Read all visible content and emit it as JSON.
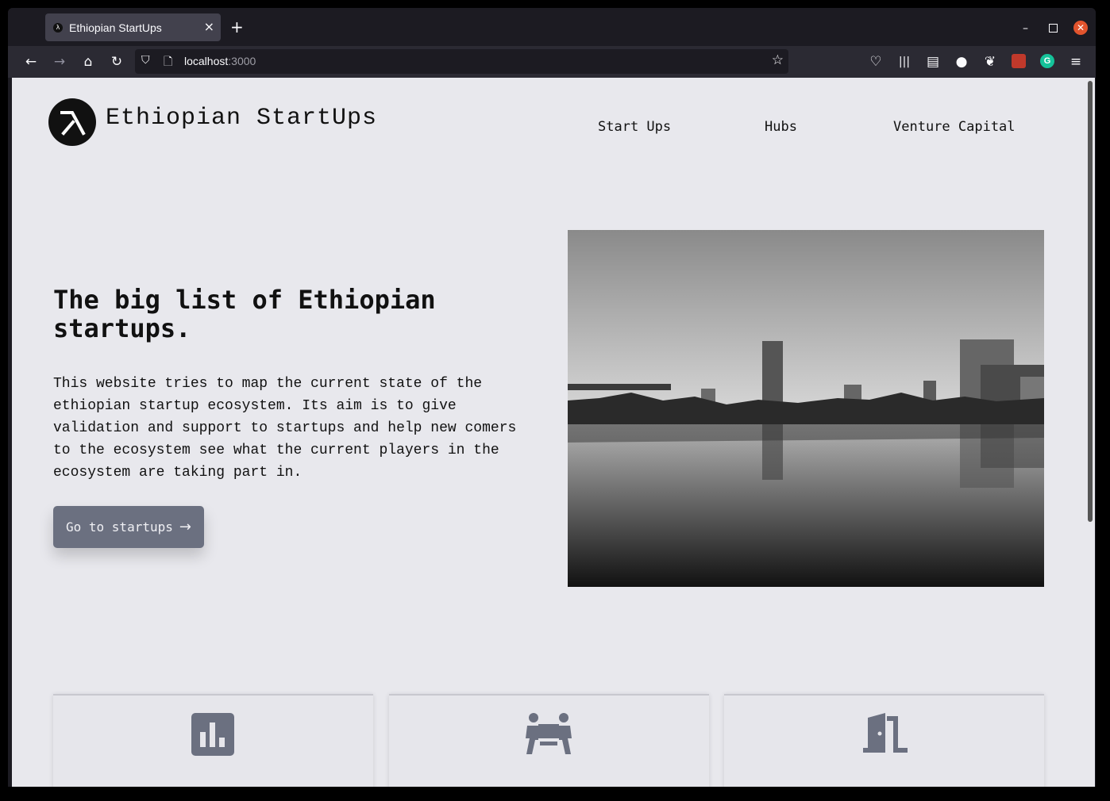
{
  "browser": {
    "tab_title": "Ethiopian StartUps",
    "tab_close": "×",
    "new_tab": "+",
    "url_host": "localhost",
    "url_port": ":3000"
  },
  "header": {
    "site_title": "Ethiopian StartUps",
    "nav": [
      {
        "label": "Start Ups"
      },
      {
        "label": "Hubs"
      },
      {
        "label": "Venture Capital"
      }
    ]
  },
  "hero": {
    "title": "The big list of Ethiopian startups.",
    "description": "This website tries to map the current state of the ethiopian startup ecosystem. Its aim is to give validation and support to startups and help new comers to the ecosystem see what the current players in the ecosystem are taking part in.",
    "cta_label": "Go to startups",
    "cta_icon": "→"
  },
  "cards": [
    {
      "icon": "bar-chart-icon"
    },
    {
      "icon": "people-carry-icon"
    },
    {
      "icon": "door-open-icon"
    }
  ],
  "colors": {
    "page_bg": "#e8e8ed",
    "button_bg": "#6b7080",
    "icon_gray": "#6b7080"
  }
}
